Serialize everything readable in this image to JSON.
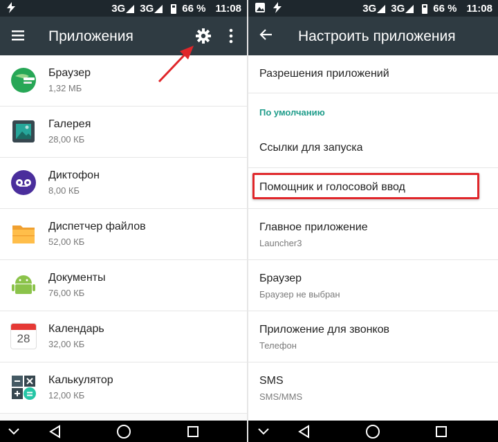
{
  "status": {
    "network1": "3G",
    "network2": "3G",
    "battery": "66 %",
    "time": "11:08"
  },
  "left": {
    "toolbar_title": "Приложения",
    "apps": [
      {
        "name": "Браузер",
        "size": "1,32 МБ",
        "icon": "browser-icon"
      },
      {
        "name": "Галерея",
        "size": "28,00 КБ",
        "icon": "gallery-icon"
      },
      {
        "name": "Диктофон",
        "size": "8,00 КБ",
        "icon": "recorder-icon"
      },
      {
        "name": "Диспетчер файлов",
        "size": "52,00 КБ",
        "icon": "folder-icon"
      },
      {
        "name": "Документы",
        "size": "76,00 КБ",
        "icon": "android-icon"
      },
      {
        "name": "Календарь",
        "size": "32,00 КБ",
        "icon": "calendar-icon",
        "calendar_day": "28"
      },
      {
        "name": "Калькулятор",
        "size": "12,00 КБ",
        "icon": "calculator-icon"
      }
    ]
  },
  "right": {
    "toolbar_title": "Настроить приложения",
    "permissions": "Разрешения приложений",
    "section_default": "По умолчанию",
    "items": [
      {
        "title": "Ссылки для запуска",
        "sub": ""
      },
      {
        "title": "Помощник и голосовой ввод",
        "sub": ""
      },
      {
        "title": "Главное приложение",
        "sub": "Launcher3"
      },
      {
        "title": "Браузер",
        "sub": "Браузер не выбран"
      },
      {
        "title": "Приложение для звонков",
        "sub": "Телефон"
      },
      {
        "title": "SMS",
        "sub": "SMS/MMS"
      }
    ]
  },
  "colors": {
    "statusbar": "#1e272d",
    "toolbar": "#2f3b42",
    "accent": "#1e9c8a",
    "highlight": "#e0262a"
  }
}
